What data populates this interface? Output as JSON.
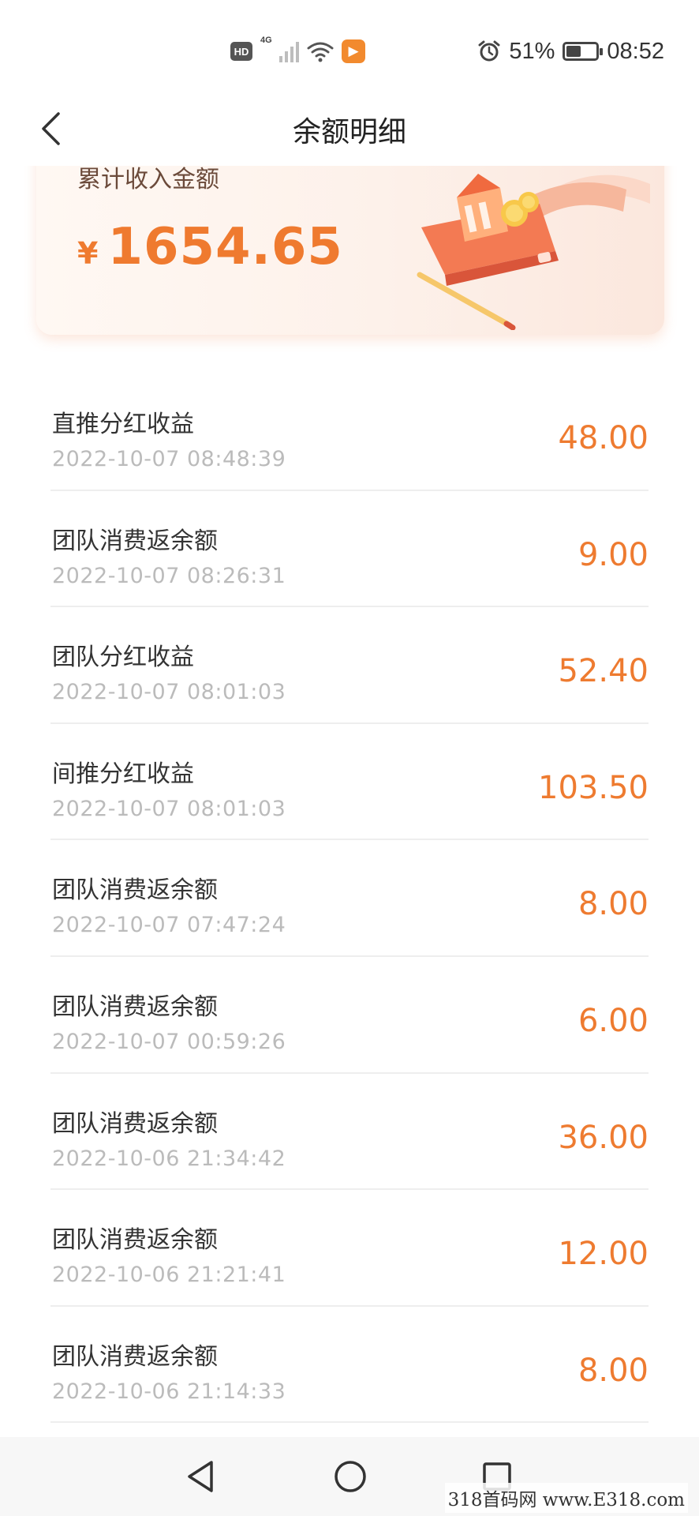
{
  "status_bar": {
    "hd_label": "HD",
    "network_label": "4G",
    "battery_percent": "51%",
    "battery_level": 0.51,
    "time": "08:52",
    "icons": [
      "hd-icon",
      "signal-icon",
      "wifi-icon",
      "app-notification-icon",
      "alarm-icon",
      "battery-icon"
    ]
  },
  "header": {
    "title": "余额明细",
    "back_icon": "chevron-left-icon"
  },
  "summary": {
    "label": "累计收入金额",
    "currency": "¥",
    "amount": "1654.65"
  },
  "transactions": [
    {
      "title": "直推分红收益",
      "time": "2022-10-07 08:48:39",
      "amount": "48.00"
    },
    {
      "title": "团队消费返余额",
      "time": "2022-10-07 08:26:31",
      "amount": "9.00"
    },
    {
      "title": "团队分红收益",
      "time": "2022-10-07 08:01:03",
      "amount": "52.40"
    },
    {
      "title": "间推分红收益",
      "time": "2022-10-07 08:01:03",
      "amount": "103.50"
    },
    {
      "title": "团队消费返余额",
      "time": "2022-10-07 07:47:24",
      "amount": "8.00"
    },
    {
      "title": "团队消费返余额",
      "time": "2022-10-07 00:59:26",
      "amount": "6.00"
    },
    {
      "title": "团队消费返余额",
      "time": "2022-10-06 21:34:42",
      "amount": "36.00"
    },
    {
      "title": "团队消费返余额",
      "time": "2022-10-06 21:21:41",
      "amount": "12.00"
    },
    {
      "title": "团队消费返余额",
      "time": "2022-10-06 21:14:33",
      "amount": "8.00"
    }
  ],
  "nav_bar": {
    "icons": [
      "nav-back-icon",
      "nav-home-icon",
      "nav-recent-icon"
    ]
  },
  "watermark": "318首码网 www.E318.com",
  "colors": {
    "accent": "#ee7b30",
    "card_bg": "#fdf1ea",
    "time_text": "#bbbbbb"
  }
}
